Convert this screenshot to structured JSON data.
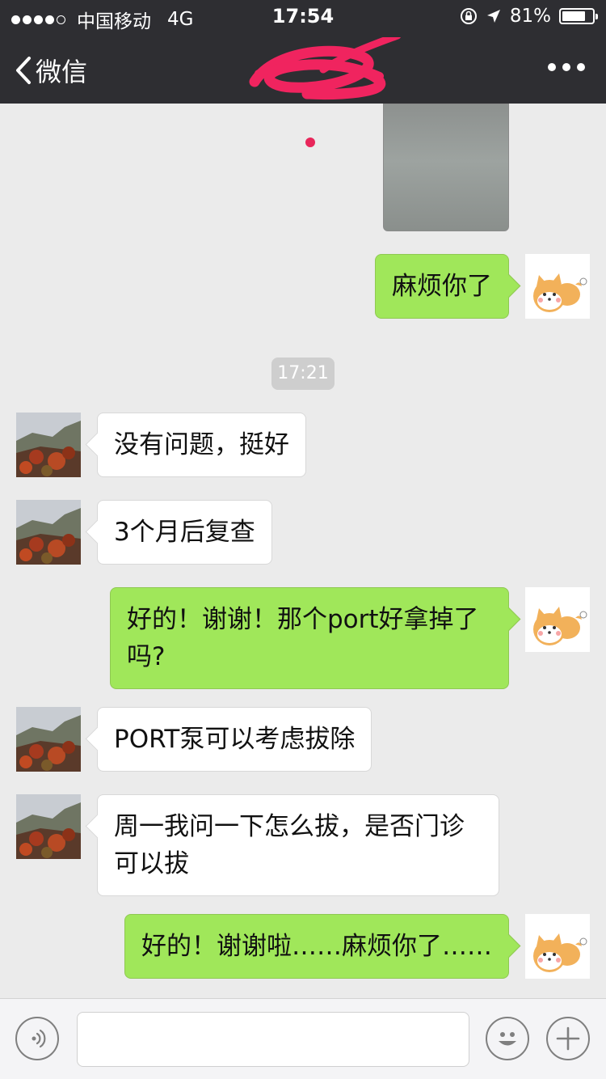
{
  "status_bar": {
    "carrier": "中国移动",
    "network": "4G",
    "time": "17:54",
    "battery_percent": "81%",
    "battery_level": 0.81,
    "signal_bars_filled": 4,
    "icons": [
      "orientation-lock-icon",
      "location-arrow-icon",
      "battery-icon"
    ]
  },
  "nav": {
    "back_label": "微信",
    "title_redacted": true,
    "more_icon": "more-dots-icon"
  },
  "messages": [
    {
      "type": "image",
      "side": "right"
    },
    {
      "type": "text",
      "side": "right",
      "text": "麻烦你了"
    },
    {
      "type": "time",
      "text": "17:21"
    },
    {
      "type": "text",
      "side": "left",
      "text": "没有问题，挺好"
    },
    {
      "type": "text",
      "side": "left",
      "text": "3个月后复查"
    },
    {
      "type": "text",
      "side": "right",
      "text": "好的！谢谢！那个port好拿掉了吗?"
    },
    {
      "type": "text",
      "side": "left",
      "text": "PORT泵可以考虑拔除"
    },
    {
      "type": "text",
      "side": "left",
      "text": "周一我问一下怎么拔，是否门诊可以拔"
    },
    {
      "type": "text",
      "side": "right",
      "text": "好的！谢谢啦……麻烦你了……"
    }
  ],
  "input_bar": {
    "text_value": "",
    "voice_icon": "voice-icon",
    "emoji_icon": "emoji-icon",
    "plus_icon": "plus-icon"
  },
  "colors": {
    "nav_bg": "#2e2e32",
    "chat_bg": "#ebebeb",
    "out_bubble": "#a0e75a",
    "in_bubble": "#ffffff",
    "redaction": "#f0245f"
  }
}
